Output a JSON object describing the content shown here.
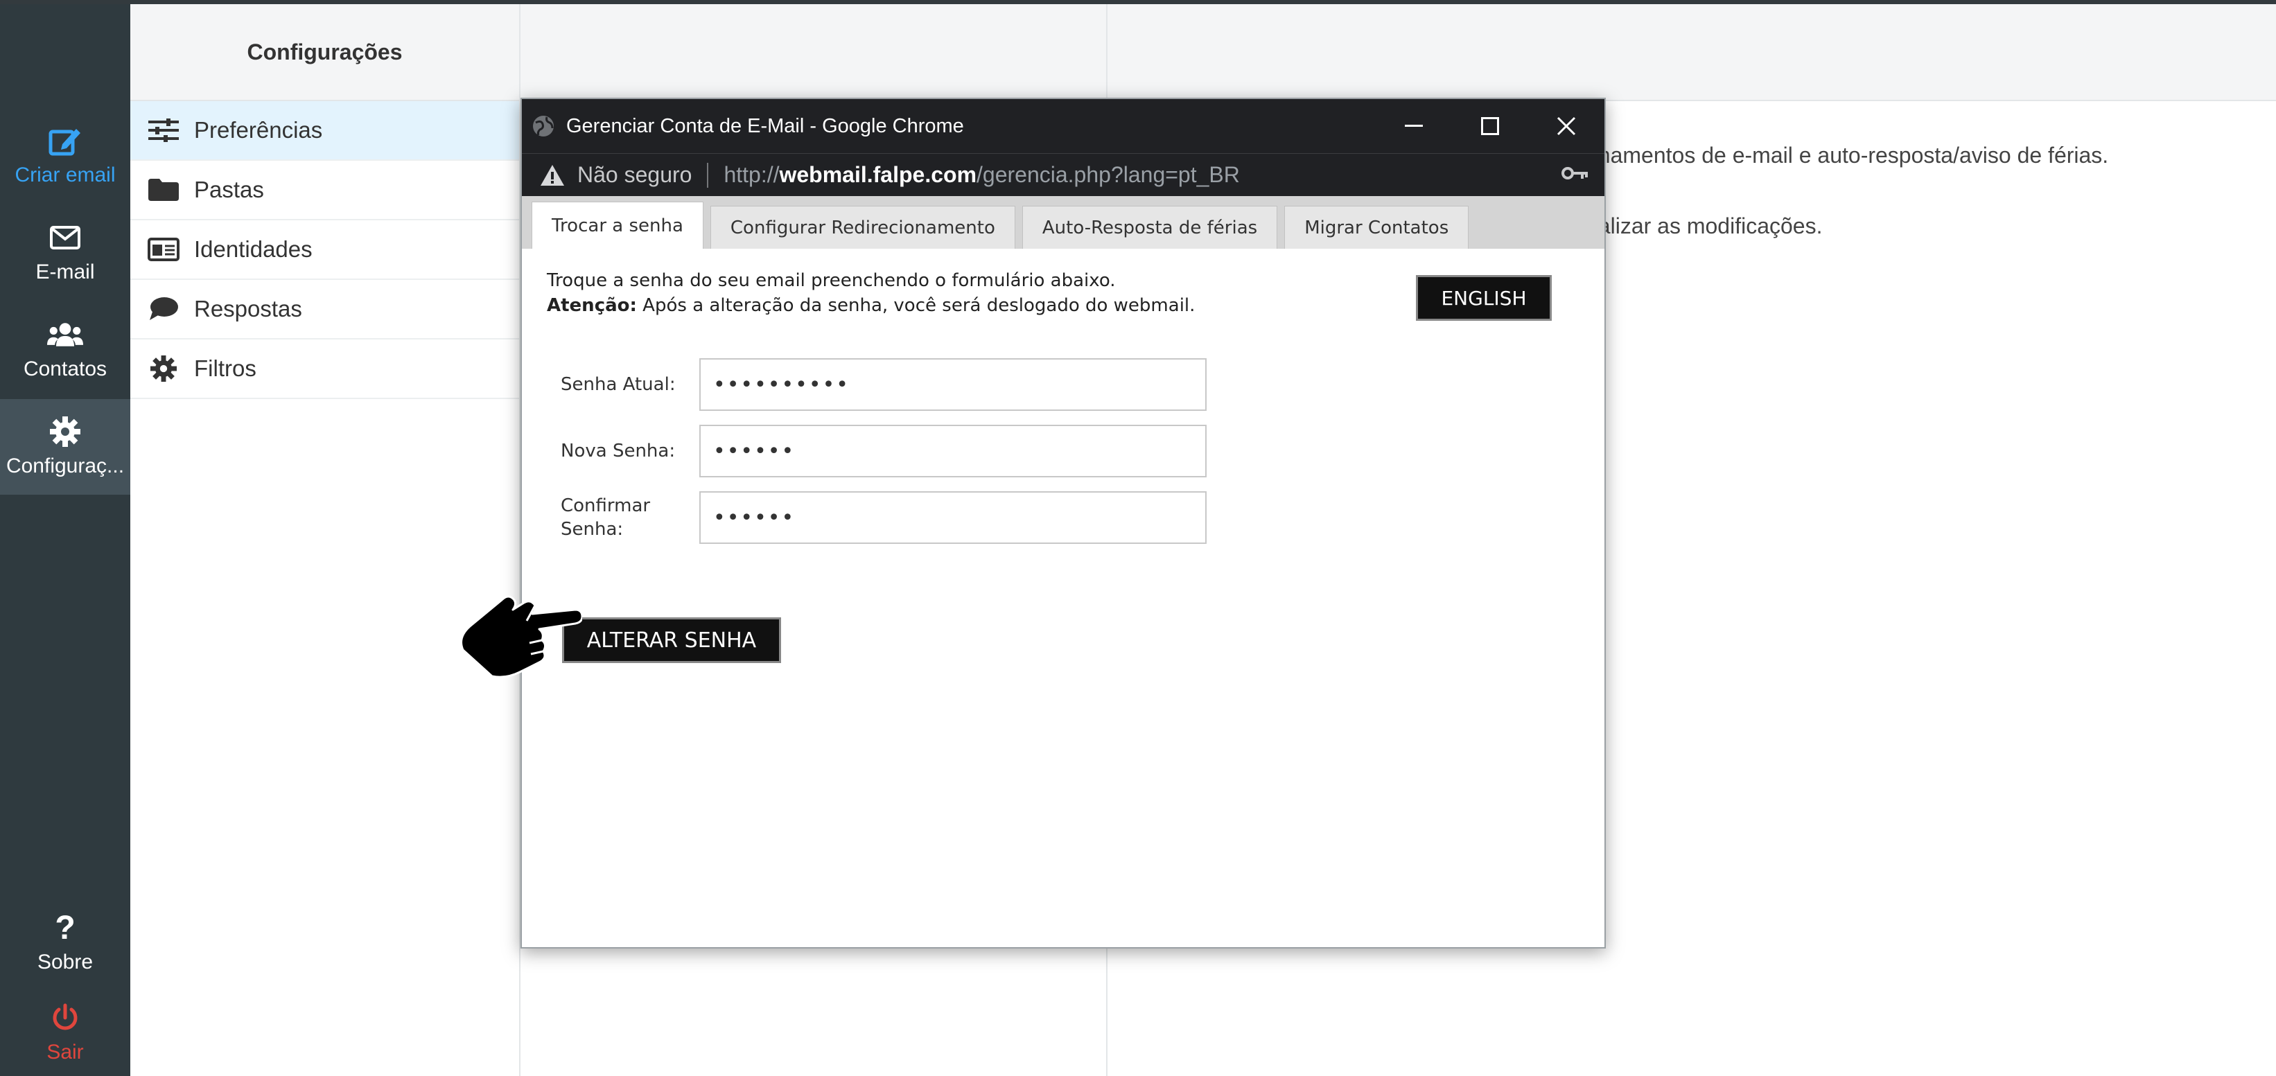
{
  "nav": {
    "compose": "Criar email",
    "mail": "E-mail",
    "contacts": "Contatos",
    "settings": "Configuraç...",
    "about": "Sobre",
    "logout": "Sair"
  },
  "settings": {
    "header": "Configurações",
    "items": [
      {
        "label": "Preferências",
        "icon": "sliders-icon"
      },
      {
        "label": "Pastas",
        "icon": "folder-icon"
      },
      {
        "label": "Identidades",
        "icon": "id-card-icon"
      },
      {
        "label": "Respostas",
        "icon": "comment-icon"
      },
      {
        "label": "Filtros",
        "icon": "gear-icon"
      }
    ]
  },
  "right": {
    "line1": "onamentos de e-mail e auto-resposta/aviso de férias.",
    "line2": "ealizar as modificações."
  },
  "popup": {
    "window_title": "Gerenciar Conta de E-Mail - Google Chrome",
    "insecure_label": "Não seguro",
    "url_scheme": "http://",
    "url_host": "webmail.falpe.com",
    "url_path": "/gerencia.php?lang=pt_BR",
    "tabs": [
      "Trocar a senha",
      "Configurar Redirecionamento",
      "Auto-Resposta de férias",
      "Migrar Contatos"
    ],
    "intro_line1": "Troque a senha do seu email preenchendo o formulário abaixo.",
    "attention_label": "Atenção:",
    "intro_line2": " Após a alteração da senha, você será deslogado do webmail.",
    "english_button": "ENGLISH",
    "fields": {
      "current_label": "Senha Atual:",
      "current_value": "••••••••••",
      "new_label": "Nova Senha:",
      "new_value": "••••••",
      "confirm_label": "Confirmar Senha:",
      "confirm_value": "••••••"
    },
    "submit_button": "ALTERAR SENHA"
  },
  "colors": {
    "nav_bg": "#2f3a3f",
    "nav_active": "#44525a",
    "compose_blue": "#37a3f4",
    "logout_red": "#e0463d",
    "selected_row": "#e3f3fd"
  }
}
